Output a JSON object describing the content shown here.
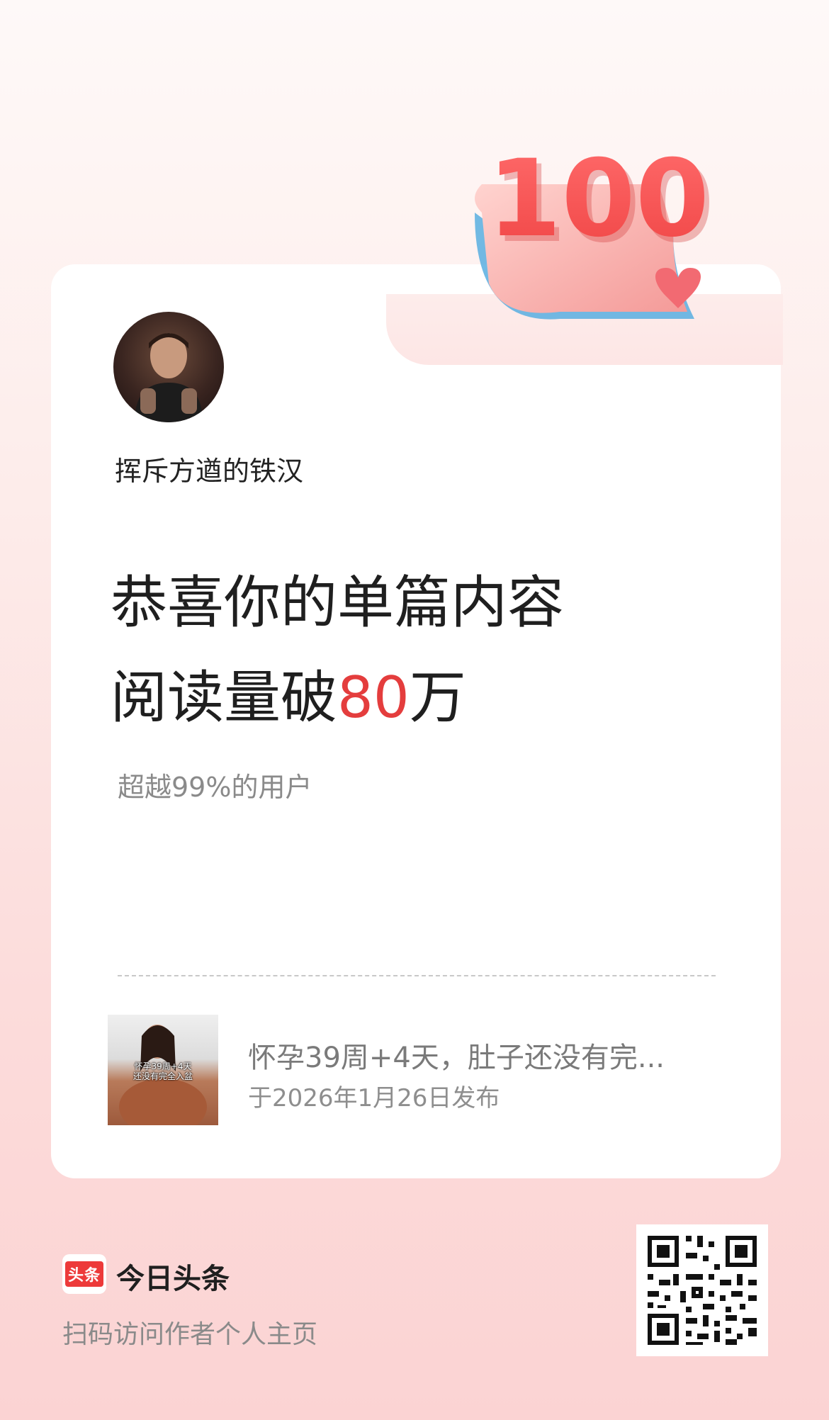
{
  "badge": {
    "number": "100"
  },
  "author": {
    "name": "挥斥方遒的铁汉"
  },
  "headline": {
    "line1": "恭喜你的单篇内容",
    "line2_prefix": "阅读量破",
    "line2_number": "80",
    "line2_suffix": "万"
  },
  "subline": "超越99%的用户",
  "article": {
    "thumbnail_caption": "怀孕39周+4天\n还没有完全入盆",
    "title": "怀孕39周+4天，肚子还没有完...",
    "date": "于2026年1月26日发布"
  },
  "brand": {
    "logo_text": "头条",
    "name": "今日头条",
    "qr_caption": "扫码访问作者个人主页"
  },
  "colors": {
    "accent": "#e43d3d",
    "brand_red": "#ed3a3a",
    "background": "#fcdcdb"
  }
}
